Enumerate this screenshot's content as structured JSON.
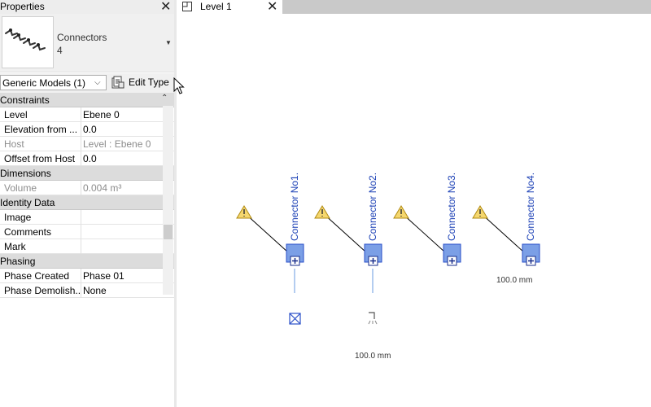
{
  "properties_panel": {
    "title": "Properties",
    "type_selector": {
      "name": "Connectors",
      "count": "4"
    },
    "filter": {
      "selected": "Generic Models (1)"
    },
    "edit_type_label": "Edit Type",
    "groups": [
      {
        "label": "Constraints",
        "rows": [
          {
            "name": "Level",
            "value": "Ebene 0"
          },
          {
            "name": "Elevation from ...",
            "value": "0.0"
          },
          {
            "name": "Host",
            "value": "Level : Ebene 0"
          },
          {
            "name": "Offset from Host",
            "value": "0.0"
          }
        ]
      },
      {
        "label": "Dimensions",
        "rows": [
          {
            "name": "Volume",
            "value": "0.004 m³"
          }
        ]
      },
      {
        "label": "Identity Data",
        "rows": [
          {
            "name": "Image",
            "value": ""
          },
          {
            "name": "Comments",
            "value": ""
          },
          {
            "name": "Mark",
            "value": ""
          }
        ]
      },
      {
        "label": "Phasing",
        "rows": [
          {
            "name": "Phase Created",
            "value": "Phase 01"
          },
          {
            "name": "Phase Demolish...",
            "value": "None"
          }
        ]
      }
    ]
  },
  "view_tab": {
    "label": "Level 1"
  },
  "canvas": {
    "connectors": [
      {
        "label": "Connector No1."
      },
      {
        "label": "Connector No2."
      },
      {
        "label": "Connector No3."
      },
      {
        "label": "Connector No4."
      }
    ],
    "dimensions": [
      "100.0 mm",
      "100.0 mm"
    ]
  },
  "colors": {
    "connector_fill": "#7b9fe6",
    "connector_stroke": "#2a4fc8",
    "connector_text": "#1a3fb5",
    "warning_fill": "#f5d76e"
  },
  "icons": {
    "close": "close-icon",
    "warning": "warning-icon",
    "edit_type": "edit-type-icon",
    "view_tab": "floor-plan-icon"
  }
}
